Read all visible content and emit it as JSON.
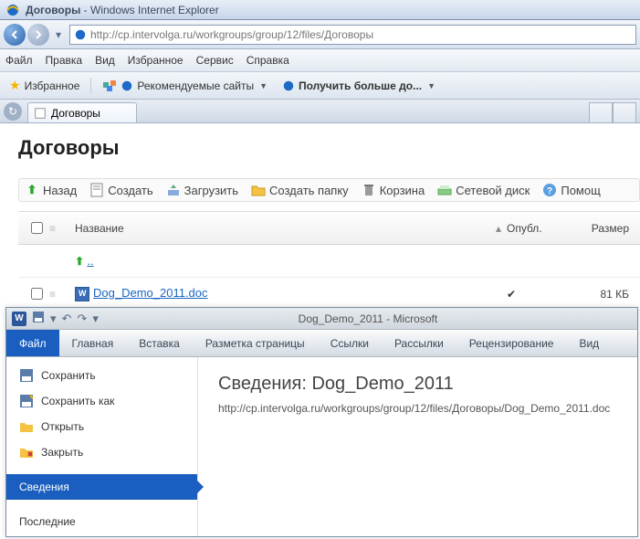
{
  "ie": {
    "title_page": "Договоры",
    "title_app": " - Windows Internet Explorer",
    "url": "http://cp.intervolga.ru/workgroups/group/12/files/Договоры",
    "menus": [
      "Файл",
      "Правка",
      "Вид",
      "Избранное",
      "Сервис",
      "Справка"
    ],
    "fav_label": "Избранное",
    "recommended": "Рекомендуемые сайты",
    "getmore": "Получить больше до...",
    "tab_label": "Договоры"
  },
  "page": {
    "heading": "Договоры",
    "toolbar": {
      "back": "Назад",
      "create": "Создать",
      "upload": "Загрузить",
      "mkfolder": "Создать папку",
      "trash": "Корзина",
      "netdisk": "Сетевой диск",
      "help": "Помощ"
    },
    "table": {
      "h_name": "Название",
      "h_publ": "Опубл.",
      "h_size": "Размер",
      "uplink": "..",
      "file": "Dog_Demo_2011.doc",
      "file_size": "81 КБ",
      "file_publ": "✔"
    }
  },
  "word": {
    "doc_title": "Dog_Demo_2011",
    "app_suffix": " - Microsoft",
    "tabs": {
      "file": "Файл",
      "home": "Главная",
      "insert": "Вставка",
      "layout": "Разметка страницы",
      "refs": "Ссылки",
      "mail": "Рассылки",
      "review": "Рецензирование",
      "view": "Вид"
    },
    "menu": {
      "save": "Сохранить",
      "saveas": "Сохранить как",
      "open": "Открыть",
      "close": "Закрыть",
      "info": "Сведения",
      "recent": "Последние"
    },
    "content": {
      "title_prefix": "Сведения: ",
      "title_doc": "Dog_Demo_2011",
      "url": "http://cp.intervolga.ru/workgroups/group/12/files/Договоры/Dog_Demo_2011.doc"
    }
  }
}
